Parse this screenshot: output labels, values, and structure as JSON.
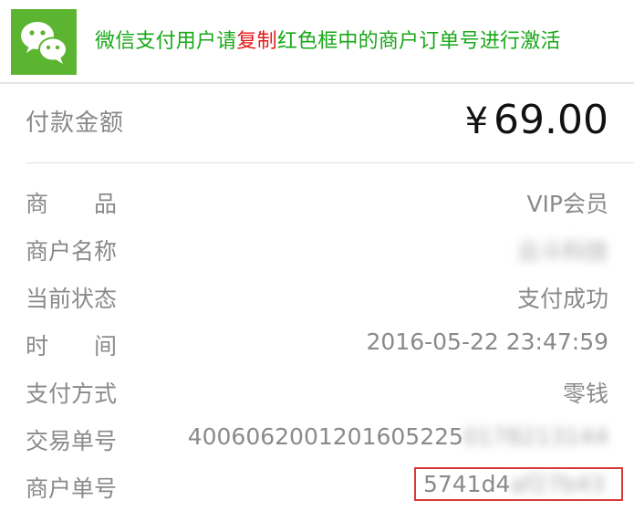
{
  "banner": {
    "logo_icon": "wechat-logo-icon",
    "text_part1": "微信支付用户请",
    "text_highlight": "复制",
    "text_part2": "红色框中的商户订单号进行激活",
    "text_color": "#19a819",
    "highlight_color": "#e41a1a",
    "logo_bg": "#5cb531"
  },
  "payment": {
    "amount_label": "付款金额",
    "currency_symbol": "¥",
    "amount": "69.00"
  },
  "details": [
    {
      "label": "商　　品",
      "value": "VIP会员"
    },
    {
      "label": "商户名称",
      "value": "云斗科技"
    },
    {
      "label": "当前状态",
      "value": "支付成功"
    },
    {
      "label": "时　　间",
      "value": "2016-05-22 23:47:59"
    },
    {
      "label": "支付方式",
      "value": "零钱"
    },
    {
      "label": "交易单号",
      "value_visible": "4006062001201605225",
      "value_blurred": "0178213144"
    },
    {
      "label": "商户单号",
      "value_visible": "5741d4",
      "value_blurred": "af27b43"
    }
  ],
  "highlight_box_color": "#d83a3a"
}
